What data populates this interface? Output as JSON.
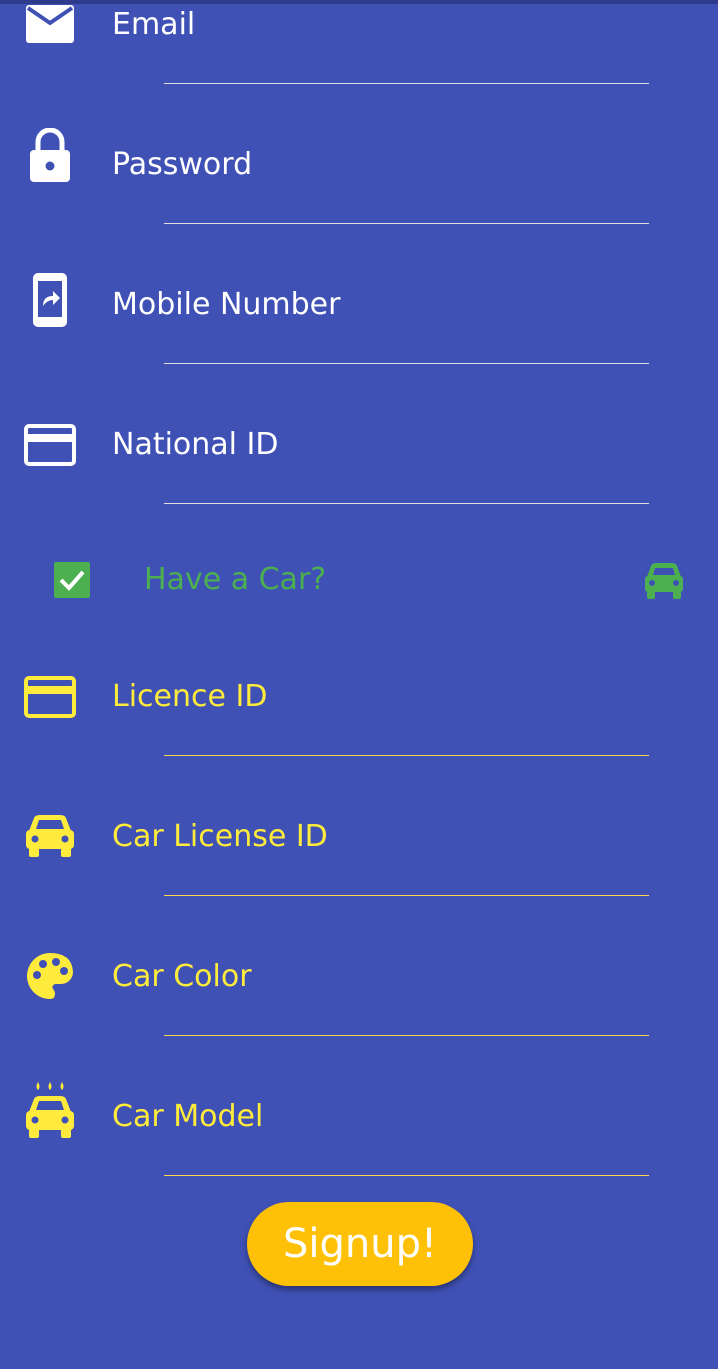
{
  "form": {
    "email_label": "Email",
    "password_label": "Password",
    "mobile_label": "Mobile Number",
    "national_id_label": "National ID",
    "have_car_label": "Have a Car?",
    "licence_id_label": "Licence ID",
    "car_license_id_label": "Car License ID",
    "car_color_label": "Car Color",
    "car_model_label": "Car Model",
    "have_car_checked": true
  },
  "signup_button": {
    "label": "Signup!"
  },
  "colors": {
    "background": "#3F51B5",
    "accent_green": "#4CAF50",
    "driver_yellow": "#FFEB3B",
    "button_amber": "#FFC107"
  },
  "icons": {
    "email": "email-icon",
    "password": "lock-icon",
    "mobile": "phone-forward-icon",
    "national_id": "card-icon",
    "have_car": "car-icon",
    "licence_id": "card-icon",
    "car_license_id": "car-icon",
    "car_color": "palette-icon",
    "car_model": "car-wash-icon"
  }
}
